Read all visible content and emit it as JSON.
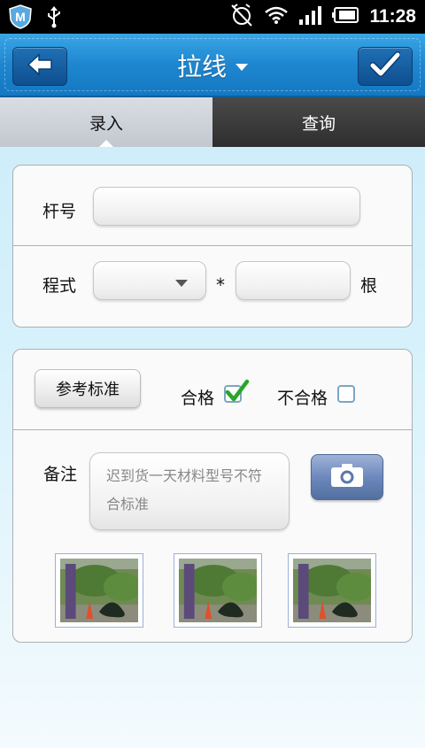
{
  "status_bar": {
    "time": "11:28",
    "icons": [
      "app-shield-icon",
      "usb-icon",
      "alarm-off-icon",
      "wifi-icon",
      "signal-icon",
      "battery-icon"
    ]
  },
  "header": {
    "title": "拉线",
    "back_icon": "back-arrow-icon",
    "confirm_icon": "checkmark-icon"
  },
  "tabs": [
    {
      "label": "录入",
      "active": true
    },
    {
      "label": "查询",
      "active": false
    }
  ],
  "form": {
    "pole_label": "杆号",
    "pole_value": "",
    "formula_label": "程式",
    "formula_select_value": "",
    "multiply_symbol": "*",
    "count_value": "",
    "unit_label": "根"
  },
  "inspection": {
    "reference_button": "参考标准",
    "qualified_label": "合格",
    "qualified_checked": true,
    "unqualified_label": "不合格",
    "unqualified_checked": false,
    "remark_label": "备注",
    "remark_text": "迟到货一天材料型号不符合标准",
    "photos": [
      "photo-1",
      "photo-2",
      "photo-3"
    ]
  },
  "colors": {
    "header_blue": "#1e86cf",
    "check_green": "#2aa52a",
    "tab_dark": "#2e2e2e"
  }
}
